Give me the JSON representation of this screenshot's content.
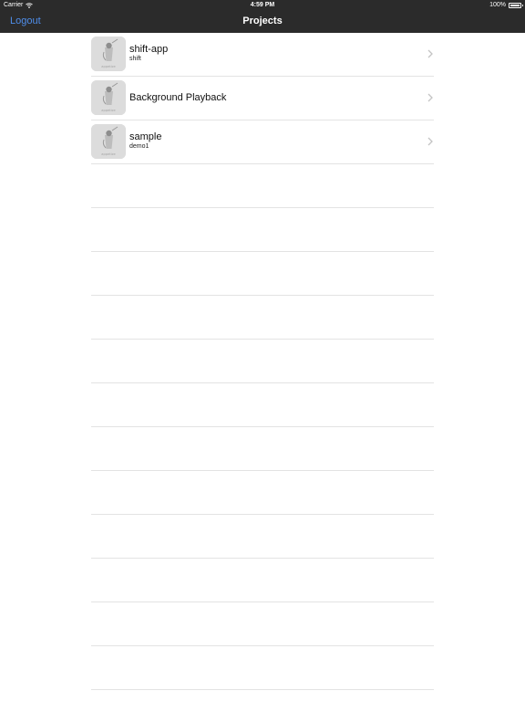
{
  "status_bar": {
    "carrier": "Carrier",
    "time": "4:59 PM",
    "battery": "100%"
  },
  "nav": {
    "left_button": "Logout",
    "title": "Projects"
  },
  "projects": [
    {
      "title": "shift-app",
      "subtitle": "shift",
      "thumbnail_label": "appetize",
      "icon": "app-placeholder-icon"
    },
    {
      "title": "Background Playback",
      "subtitle": "",
      "thumbnail_label": "appetize",
      "icon": "app-placeholder-icon"
    },
    {
      "title": "sample",
      "subtitle": "demo1",
      "thumbnail_label": "appetize",
      "icon": "app-placeholder-icon"
    }
  ],
  "colors": {
    "nav_background": "#2b2b2b",
    "nav_button": "#4f8eea",
    "separator": "#e3e3e3"
  }
}
